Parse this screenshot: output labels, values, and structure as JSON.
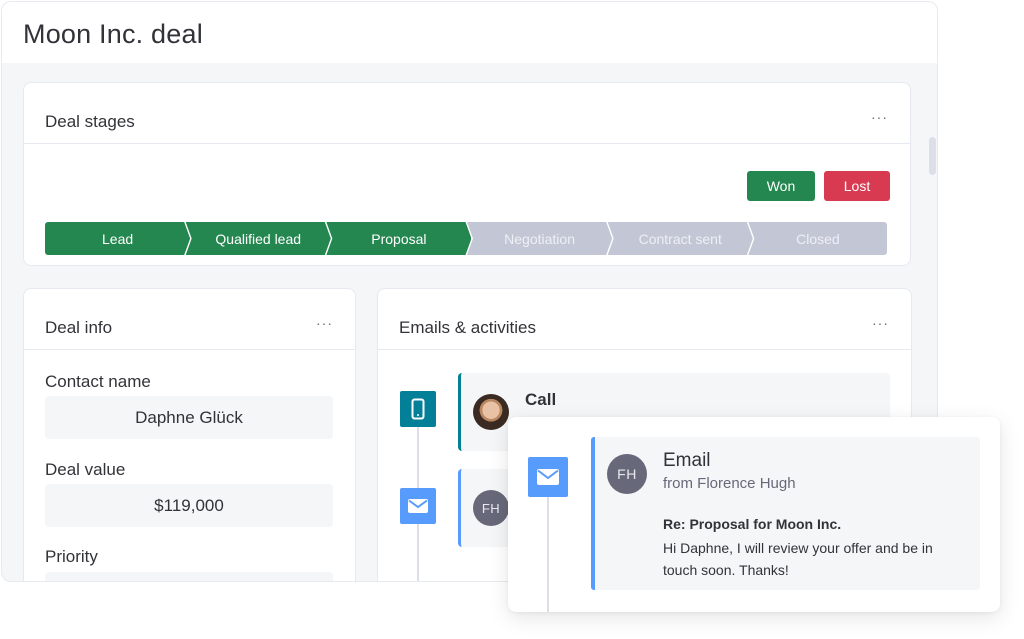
{
  "page": {
    "title": "Moon Inc. deal"
  },
  "deal_stages": {
    "title": "Deal stages",
    "menu_icon": "more-horizontal-icon",
    "menu_label": "···",
    "won_label": "Won",
    "lost_label": "Lost",
    "colors": {
      "done": "#258750",
      "todo": "#c3c6d4",
      "won": "#258750",
      "lost": "#d83a52"
    },
    "stages": [
      {
        "label": "Lead",
        "status": "done"
      },
      {
        "label": "Qualified lead",
        "status": "done"
      },
      {
        "label": "Proposal",
        "status": "done"
      },
      {
        "label": "Negotiation",
        "status": "todo"
      },
      {
        "label": "Contract sent",
        "status": "todo"
      },
      {
        "label": "Closed",
        "status": "todo"
      }
    ]
  },
  "deal_info": {
    "title": "Deal info",
    "menu_label": "···",
    "fields": [
      {
        "label": "Contact name",
        "value": "Daphne Glück"
      },
      {
        "label": "Deal value",
        "value": "$119,000"
      },
      {
        "label": "Priority",
        "value": ""
      }
    ]
  },
  "activities": {
    "title": "Emails & activities",
    "menu_label": "···",
    "items": [
      {
        "type": "Call",
        "icon": "phone-icon",
        "avatar": "photo"
      },
      {
        "type": "Email",
        "icon": "mail-icon",
        "avatar_initials": "FH"
      }
    ]
  },
  "email_popup": {
    "icon": "mail-icon",
    "avatar_initials": "FH",
    "title": "Email",
    "from": "from Florence Hugh",
    "subject": "Re: Proposal for Moon Inc.",
    "body": "Hi Daphne, I will review your offer and be in touch soon. Thanks!"
  }
}
